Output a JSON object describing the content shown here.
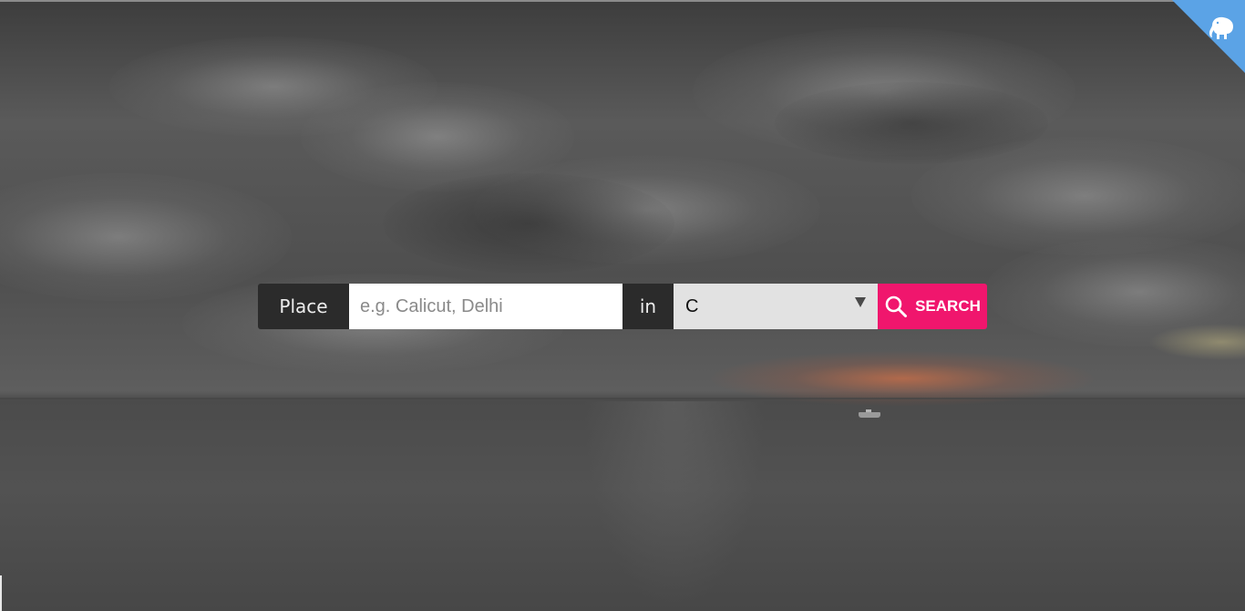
{
  "search": {
    "place_label": "Place",
    "place_placeholder": "e.g. Calicut, Delhi",
    "place_value": "",
    "in_label": "in",
    "category_selected": "C",
    "search_button_label": "SEARCH",
    "search_icon": "search-icon"
  },
  "corner": {
    "logo_icon": "elephant-logo-icon"
  },
  "colors": {
    "accent": "#f0166d",
    "corner_ribbon": "#5ba3e6",
    "label_bg": "#2b2b2b",
    "select_bg": "#e2e2e2"
  }
}
